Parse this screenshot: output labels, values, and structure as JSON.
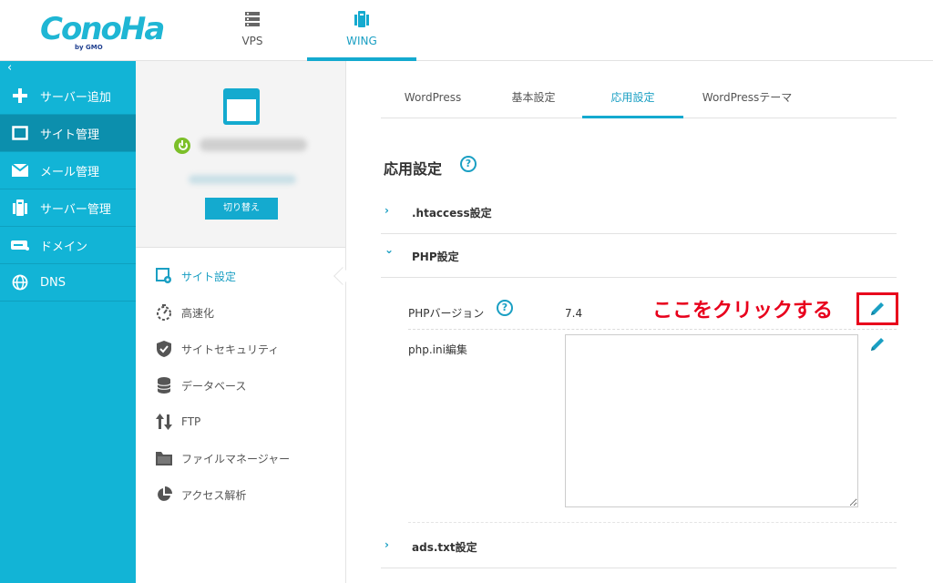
{
  "brand": {
    "logo_text": "ConoHa",
    "logo_sub": "by GMO"
  },
  "topnav": {
    "vps_label": "VPS",
    "wing_label": "WING"
  },
  "sidebar": {
    "collapse_glyph": "‹",
    "items": [
      {
        "label": "サーバー追加",
        "icon": "plus-icon"
      },
      {
        "label": "サイト管理",
        "icon": "window-icon"
      },
      {
        "label": "メール管理",
        "icon": "mail-icon"
      },
      {
        "label": "サーバー管理",
        "icon": "server-icon"
      },
      {
        "label": "ドメイン",
        "icon": "domain-icon"
      },
      {
        "label": "DNS",
        "icon": "globe-icon"
      }
    ],
    "active_index": 1
  },
  "site_card": {
    "switch_label": "切り替え"
  },
  "mid_menu": [
    {
      "label": "サイト設定",
      "icon": "site-settings-icon"
    },
    {
      "label": "高速化",
      "icon": "timer-icon"
    },
    {
      "label": "サイトセキュリティ",
      "icon": "shield-icon"
    },
    {
      "label": "データベース",
      "icon": "database-icon"
    },
    {
      "label": "FTP",
      "icon": "transfer-icon"
    },
    {
      "label": "ファイルマネージャー",
      "icon": "folder-icon"
    },
    {
      "label": "アクセス解析",
      "icon": "pie-chart-icon"
    }
  ],
  "tabs": [
    "WordPress",
    "基本設定",
    "応用設定",
    "WordPressテーマ"
  ],
  "section": {
    "title": "応用設定",
    "help": "?"
  },
  "accordions": {
    "htaccess": {
      "chevron": "›",
      "title": ".htaccess設定"
    },
    "php": {
      "chevron": "⌄",
      "title": "PHP設定"
    },
    "adstxt": {
      "chevron": "›",
      "title": "ads.txt設定"
    }
  },
  "php": {
    "version_label": "PHPバージョン",
    "version_value": "7.4",
    "ini_label": "php.ini編集",
    "ini_value": ""
  },
  "annotation": {
    "text": "ここをクリックする",
    "color": "#e8001c"
  },
  "colors": {
    "accent": "#14aacf",
    "sidebar": "#12b4d6",
    "sidebar_active": "#0c8fad",
    "power": "#7cbf29"
  }
}
